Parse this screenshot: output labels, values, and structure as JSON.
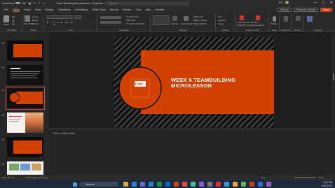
{
  "titlebar": {
    "autosave_label": "AutoSave",
    "toggle_state": "Off",
    "doc_title": "Team Building Microlessons Template • Saved to Drive",
    "search_placeholder": "Search",
    "user_initials": "PC",
    "minimize": "—",
    "maximize": "▢",
    "close": "✕"
  },
  "menu": {
    "tabs": [
      "File",
      "Home",
      "Insert",
      "Draw",
      "Design",
      "Transitions",
      "Animations",
      "Slide Show",
      "Record",
      "Review",
      "View",
      "Help",
      "Acrobat"
    ],
    "active_tab": "Home",
    "record_btn": "Record",
    "present_btn": "Present in Teams",
    "share_btn": "Share"
  },
  "ribbon": {
    "groups": [
      {
        "name": "Clipboard",
        "items": [
          "Paste",
          "Cut",
          "Copy",
          "Format Painter"
        ]
      },
      {
        "name": "Slides",
        "items": [
          "New Slide",
          "Reuse Slides",
          "Layout",
          "Reset",
          "Section"
        ]
      },
      {
        "name": "Font",
        "items": [
          "B",
          "I",
          "U",
          "S",
          "ab",
          "AV",
          "Aa"
        ]
      },
      {
        "name": "Paragraph",
        "items": [
          "Text Direction",
          "Align Text",
          "Convert to SmartArt"
        ]
      },
      {
        "name": "Drawing",
        "items": [
          "Arrange",
          "Quick Styles",
          "Shape Fill",
          "Shape Outline",
          "Shape Effects"
        ]
      },
      {
        "name": "Editing",
        "items": [
          "Find",
          "Replace",
          "Select"
        ]
      },
      {
        "name": "Adobe Acrobat",
        "items": [
          "Create PDF and Share link",
          "Create PDF and Share via Outlook"
        ]
      },
      {
        "name": "Voice",
        "items": [
          "Dictate"
        ]
      },
      {
        "name": "Sensitivity",
        "items": [
          "Sensitivity"
        ]
      },
      {
        "name": "Add-ins",
        "items": [
          "Add-ins"
        ]
      },
      {
        "name": "Designer",
        "items": [
          "Designer"
        ]
      }
    ]
  },
  "slides": [
    {
      "num": "15",
      "type": "dark-orange"
    },
    {
      "num": "16",
      "type": "dark-text"
    },
    {
      "num": "17",
      "type": "dark-circle",
      "selected": true
    },
    {
      "num": "18",
      "type": "photo-sunset"
    },
    {
      "num": "19",
      "type": "dark-orange"
    },
    {
      "num": "20",
      "type": "light-photos"
    }
  ],
  "main_slide": {
    "title_line1": "WEEK 6 TEAMBUILDING",
    "title_line2": "MICROLESSON",
    "logo_text": "Logo",
    "colors": {
      "orange": "#d14100",
      "dark": "#0d0d0d",
      "stripe": "#3a3a3a"
    }
  },
  "notes": {
    "placeholder": "Click to add notes"
  },
  "status": {
    "slide_info": "Slide 17 of 27",
    "accessibility": "Accessibility: Good to go",
    "notes_btn": "Notes",
    "zoom": "66%"
  },
  "taskbar": {
    "search_label": "Search",
    "time": "2:06 PM",
    "date": "9/30/2024"
  }
}
